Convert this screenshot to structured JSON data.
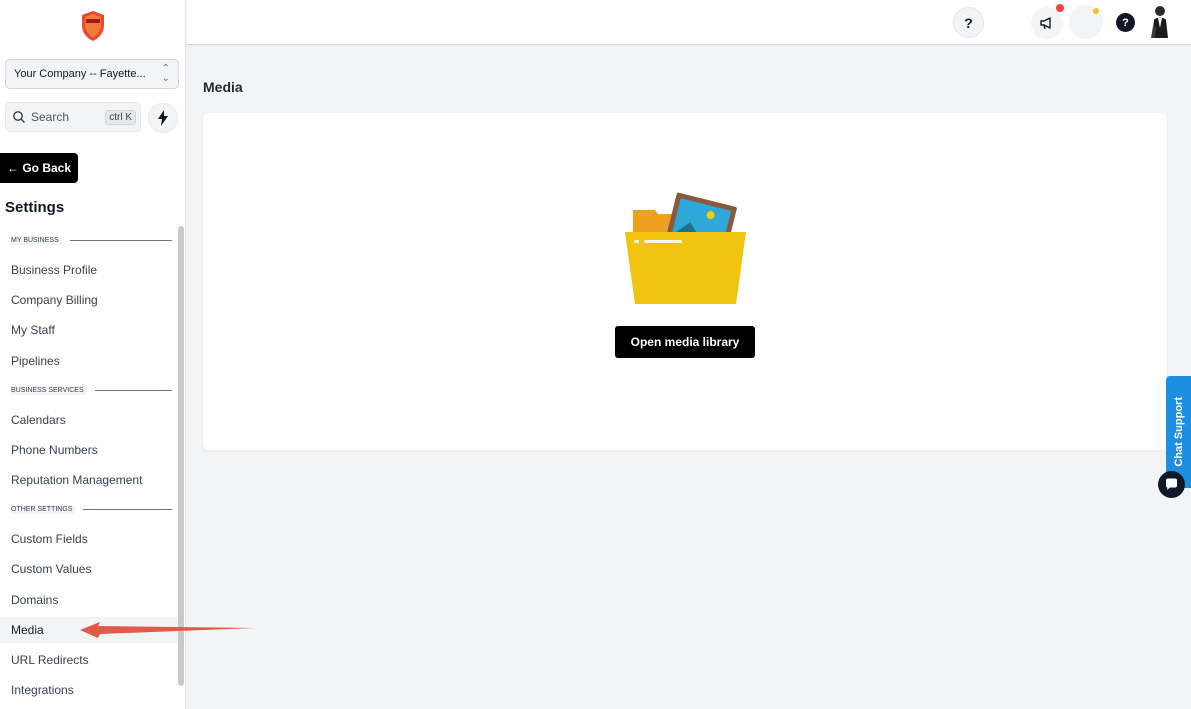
{
  "sidebar": {
    "company_select": "Your Company -- Fayette...",
    "search": {
      "label": "Search",
      "shortcut": "ctrl K"
    },
    "go_back": "← Go Back",
    "settings_title": "Settings",
    "sections": [
      {
        "title": "MY BUSINESS",
        "items": [
          "Business Profile",
          "Company Billing",
          "My Staff",
          "Pipelines"
        ]
      },
      {
        "title": "BUSINESS SERVICES",
        "items": [
          "Calendars",
          "Phone Numbers",
          "Reputation Management"
        ]
      },
      {
        "title": "OTHER SETTINGS",
        "items": [
          "Custom Fields",
          "Custom Values",
          "Domains",
          "Media",
          "URL Redirects",
          "Integrations"
        ]
      }
    ],
    "active_item": "Media"
  },
  "topbar": {
    "help_label": "?",
    "question_label": "?"
  },
  "main": {
    "page_title": "Media",
    "open_library_button": "Open media library"
  },
  "chat_support": {
    "label": "Chat Support"
  },
  "icons": {
    "logo": "shield-logo-icon",
    "search": "search-icon",
    "quick_action": "lightning-icon",
    "announcement": "megaphone-icon",
    "folder": "folder-illustration-icon",
    "chat": "chat-bubble-icon"
  },
  "colors": {
    "primary_button": "#000000",
    "chat_support": "#1d8fe1",
    "notification_dot": "#ef4444",
    "status_dot": "#fbbf24",
    "folder": "#f1c40f",
    "annotation_arrow": "#e05a47"
  }
}
